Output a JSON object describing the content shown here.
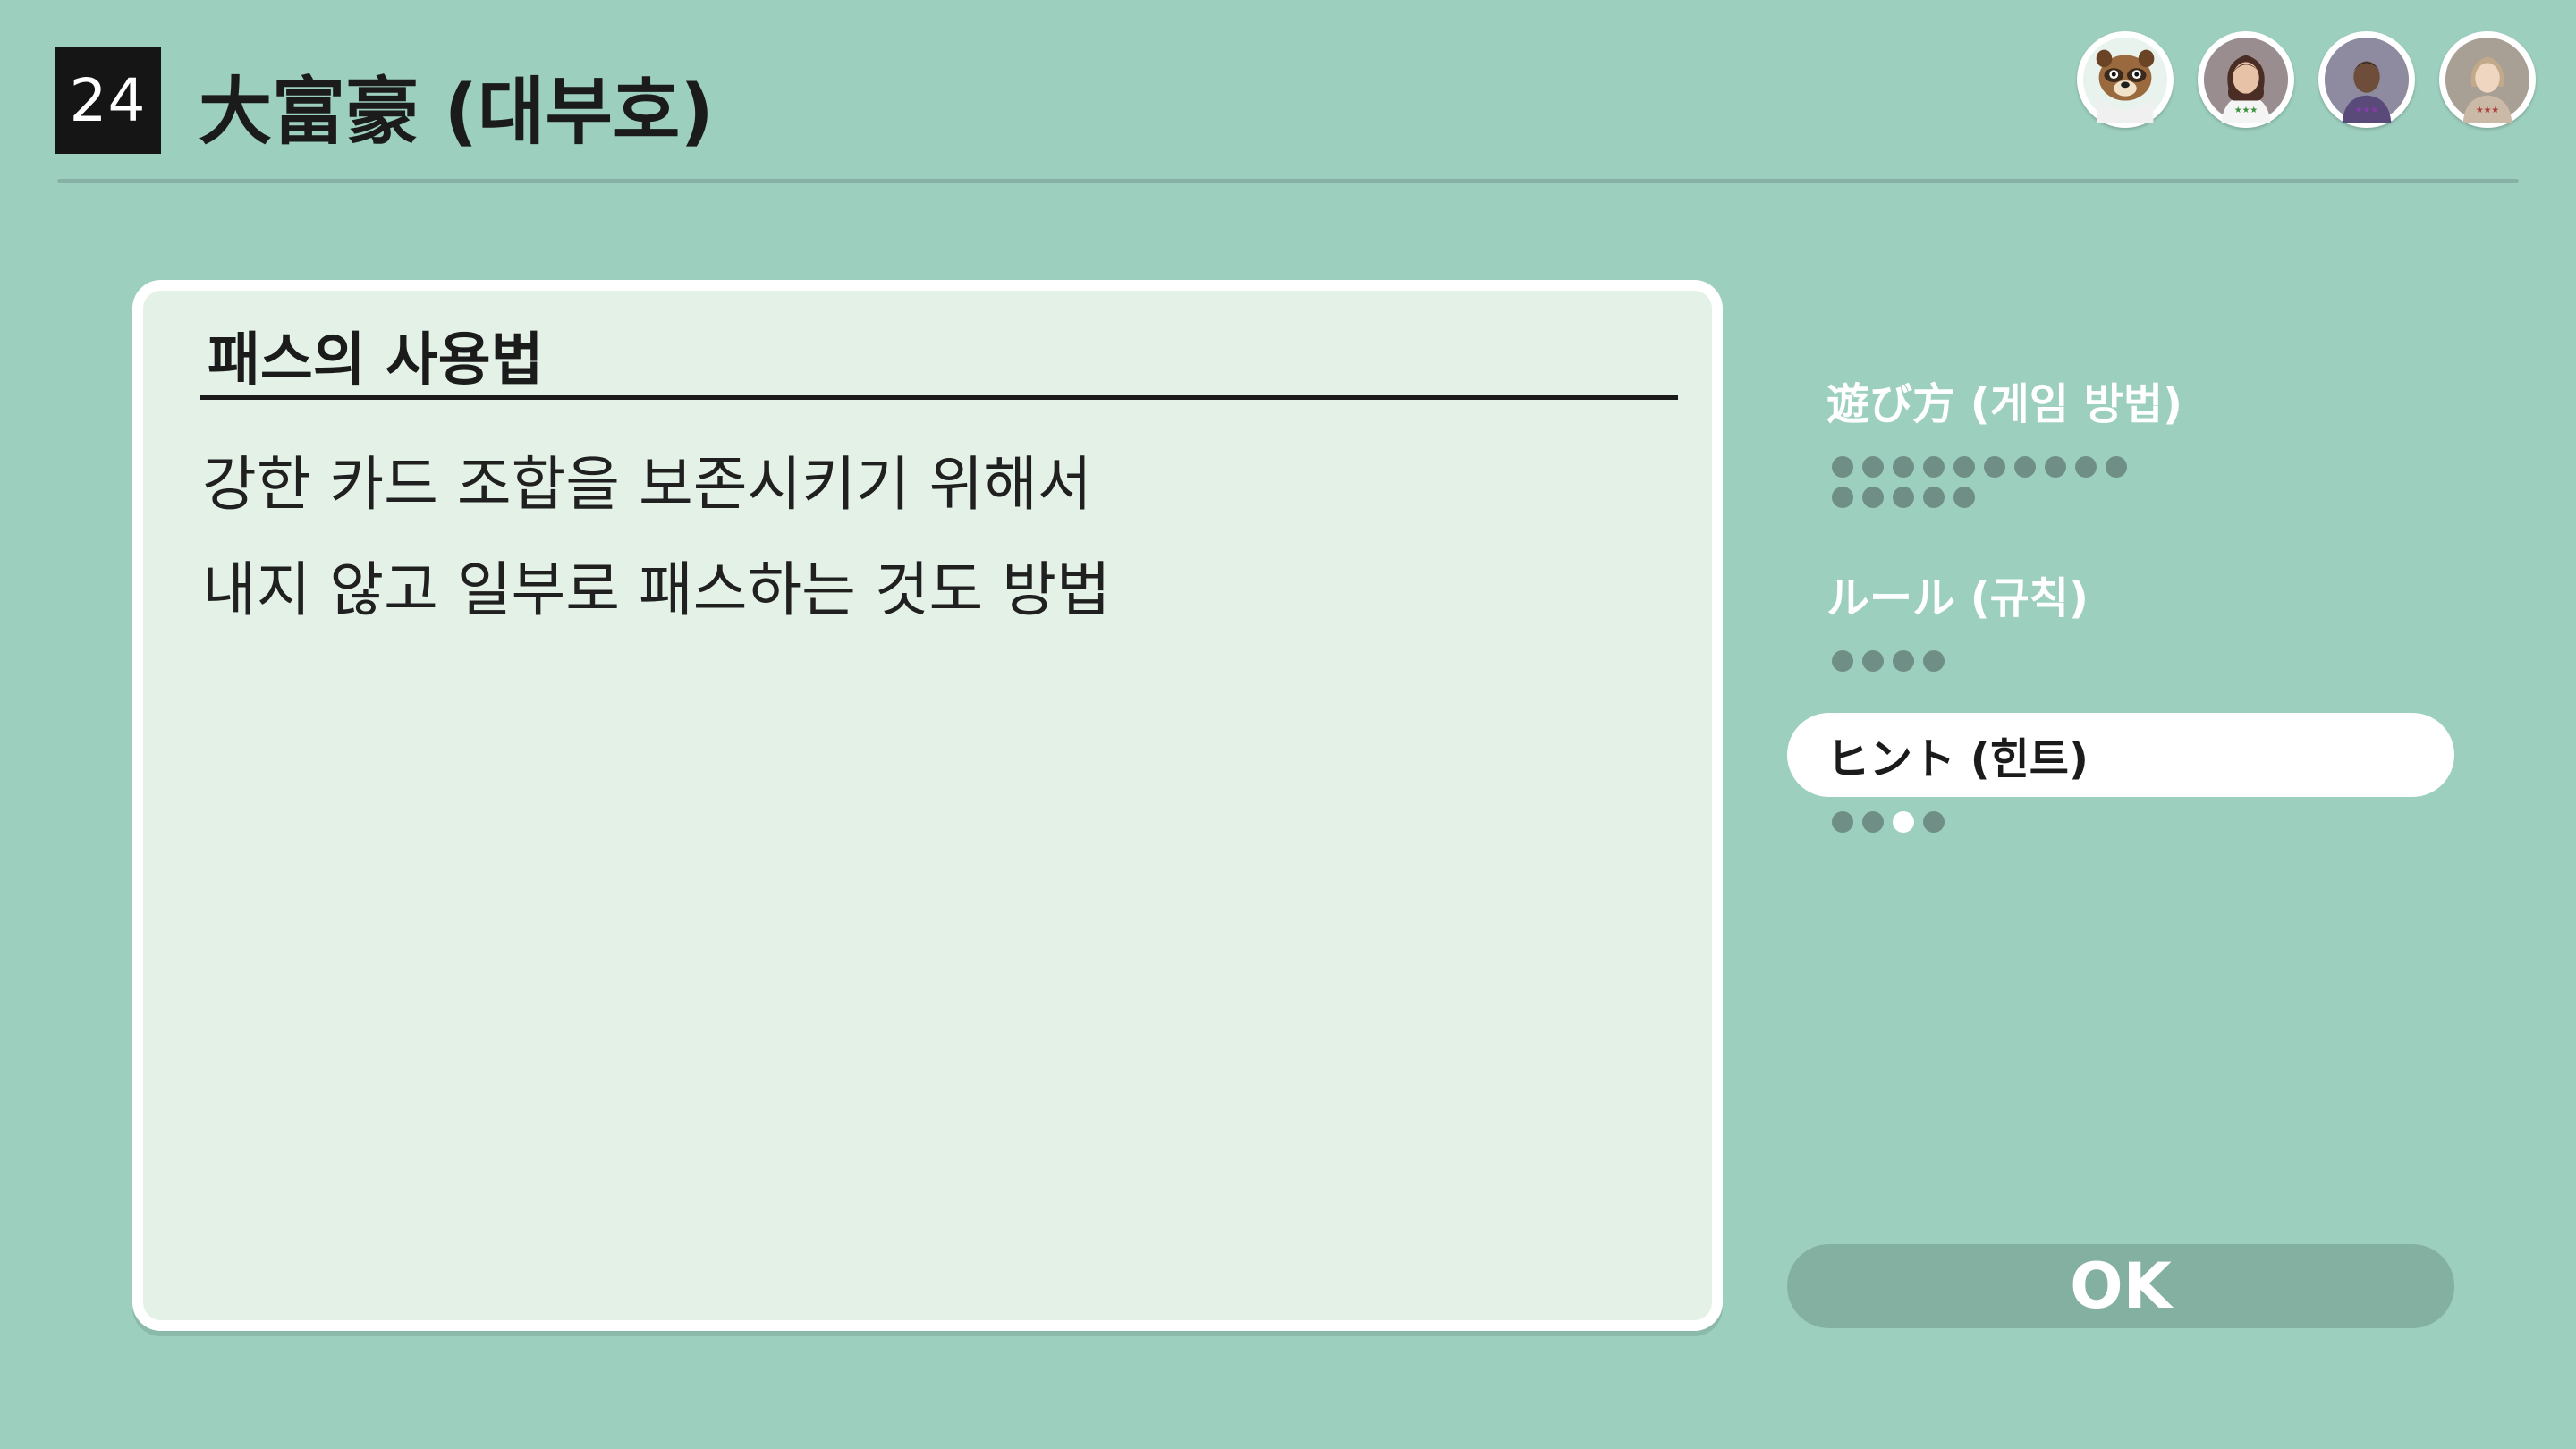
{
  "header": {
    "game_number": "24",
    "title": "大富豪 (대부호)"
  },
  "avatars": [
    {
      "name": "raccoon-avatar-icon"
    },
    {
      "name": "player-avatar-icon"
    },
    {
      "name": "player-avatar-icon"
    },
    {
      "name": "player-avatar-icon"
    }
  ],
  "panel": {
    "heading": "패스의 사용법",
    "lines": [
      "강한 카드 조합을 보존시키기 위해서",
      "내지 않고 일부로 패스하는 것도 방법"
    ]
  },
  "menu": {
    "items": [
      {
        "label": "遊び方 (게임 방법)",
        "active": false,
        "page_count": 15,
        "current_page": 0
      },
      {
        "label": "ルール (규칙)",
        "active": false,
        "page_count": 4,
        "current_page": 0
      },
      {
        "label": "ヒント (힌트)",
        "active": true,
        "page_count": 4,
        "current_page": 3
      }
    ]
  },
  "ok_button": {
    "label": "OK"
  },
  "colors": {
    "background": "#9ccfbe",
    "panel": "#e3f1e7",
    "dot": "#6f8f86",
    "ok_button": "#84b0a2"
  }
}
